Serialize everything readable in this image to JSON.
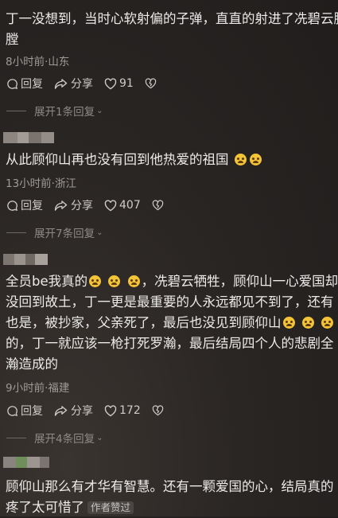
{
  "actions": {
    "reply": "回复",
    "share": "分享"
  },
  "comments": [
    {
      "text_parts": [
        "丁一没想到，当时心软射偏的子弹，直直的射进了冼碧云胸",
        "膛"
      ],
      "meta": "8小时前·山东",
      "likes": "91",
      "replies": "展开1条回复"
    },
    {
      "text": "从此顾仰山再也没有回到他热爱的祖国",
      "meta": "13小时前·浙江",
      "likes": "407",
      "replies": "展开7条回复"
    },
    {
      "text_parts": [
        "全员be我真的",
        "，冼碧云牺牲，顾仰山一心爱国却",
        "没回到故土，丁一更是最重要的人永远都见不到了，还有",
        "也是，被抄家，父亲死了，最后也没见到顾仰山",
        "的，丁一就应该一枪打死罗瀚，最后结局四个人的悲剧全",
        "瀚造成的"
      ],
      "meta": "9小时前·福建",
      "likes": "172",
      "replies": "展开4条回复"
    },
    {
      "text_parts": [
        "顾仰山那么有才华有智慧。还有一颗爱国的心，结局真的",
        "疼了太可惜了"
      ],
      "tag": "作者赞过"
    }
  ]
}
